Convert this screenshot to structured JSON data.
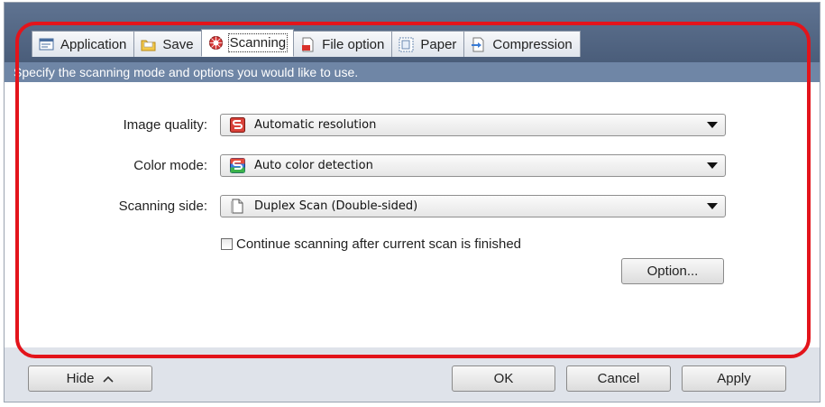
{
  "tabs": [
    {
      "label": "Application",
      "icon": "application-icon"
    },
    {
      "label": "Save",
      "icon": "folder-icon"
    },
    {
      "label": "Scanning",
      "icon": "scanning-icon"
    },
    {
      "label": "File option",
      "icon": "file-option-icon"
    },
    {
      "label": "Paper",
      "icon": "paper-icon"
    },
    {
      "label": "Compression",
      "icon": "compression-icon"
    }
  ],
  "active_tab": "Scanning",
  "description": "Specify the scanning mode and options you would like to use.",
  "settings": {
    "image_quality": {
      "label": "Image quality:",
      "value": "Automatic resolution",
      "icon": "scansnap-red-icon"
    },
    "color_mode": {
      "label": "Color mode:",
      "value": "Auto color detection",
      "icon": "scansnap-color-icon"
    },
    "scanning_side": {
      "label": "Scanning side:",
      "value": "Duplex Scan (Double-sided)",
      "icon": "document-page-icon"
    }
  },
  "continue_scanning": {
    "label": "Continue scanning after current scan is finished",
    "checked": false
  },
  "buttons": {
    "option": "Option...",
    "hide": "Hide",
    "ok": "OK",
    "cancel": "Cancel",
    "apply": "Apply"
  },
  "colors": {
    "highlight": "#e3141b",
    "description_bar": "#6f86a6",
    "header": "#5f7391"
  }
}
